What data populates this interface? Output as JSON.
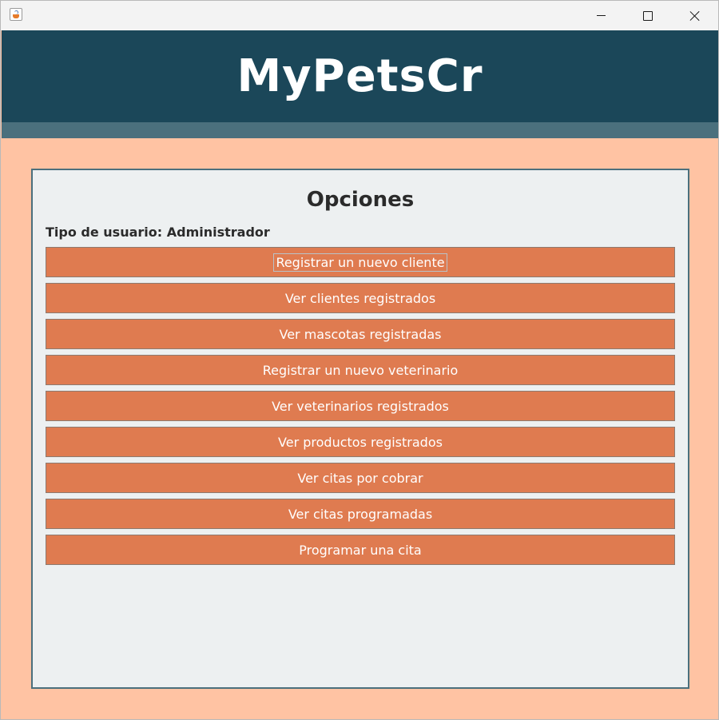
{
  "window": {
    "icon": "java-cup-icon",
    "controls": {
      "minimize": "minimize-icon",
      "maximize": "maximize-icon",
      "close": "close-icon"
    }
  },
  "header": {
    "title": "MyPetsCr"
  },
  "panel": {
    "title": "Opciones",
    "user_type": "Tipo de usuario: Administrador",
    "buttons": [
      {
        "label": "Registrar un nuevo cliente",
        "focused": true
      },
      {
        "label": "Ver clientes registrados"
      },
      {
        "label": "Ver mascotas registradas"
      },
      {
        "label": "Registrar un nuevo veterinario"
      },
      {
        "label": "Ver veterinarios registrados"
      },
      {
        "label": "Ver productos registrados"
      },
      {
        "label": "Ver citas por cobrar"
      },
      {
        "label": "Ver citas programadas"
      },
      {
        "label": "Programar una cita"
      }
    ]
  },
  "colors": {
    "header_bg": "#1b4759",
    "header_strip": "#4b707d",
    "page_bg": "#ffc3a3",
    "panel_bg": "#edf0f1",
    "button_bg": "#df7b50",
    "button_text": "#ffffff"
  }
}
